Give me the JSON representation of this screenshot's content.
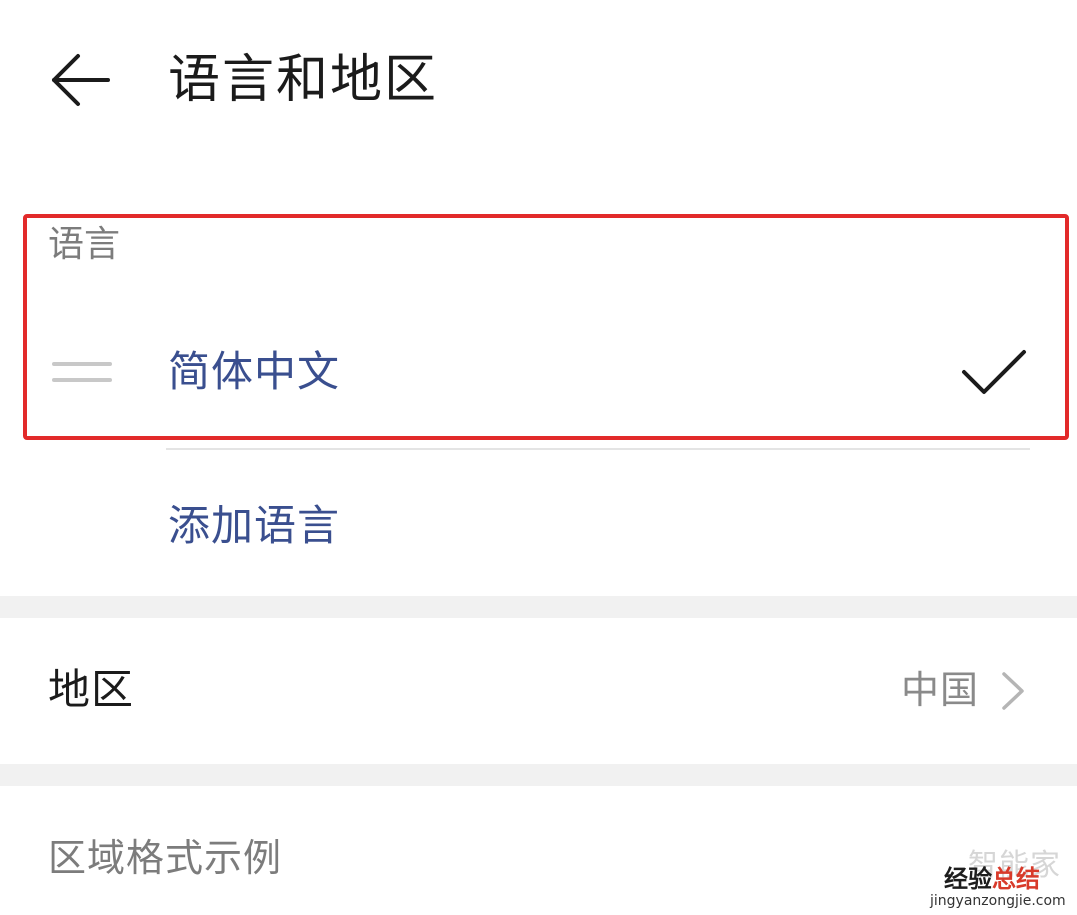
{
  "header": {
    "back_icon": "arrow-left-icon",
    "title": "语言和地区"
  },
  "language_section": {
    "label": "语言",
    "languages": [
      {
        "name": "简体中文",
        "selected": true,
        "drag_icon": "drag-handle-icon",
        "check_icon": "checkmark-icon"
      }
    ],
    "add_language_label": "添加语言",
    "highlight_color": "#e22a2a"
  },
  "region_section": {
    "label": "地区",
    "value": "中国",
    "chevron_icon": "chevron-right-icon"
  },
  "format_section": {
    "title": "区域格式示例"
  },
  "watermark": {
    "top": "智能家",
    "main_prefix": "经验",
    "main_accent": "总结",
    "url": "jingyanzongjie.com"
  },
  "colors": {
    "accent_blue": "#3a4f8f",
    "secondary_text": "#7c7c7c",
    "primary_text": "#1b1b1b",
    "section_gap": "#f1f1f1"
  }
}
